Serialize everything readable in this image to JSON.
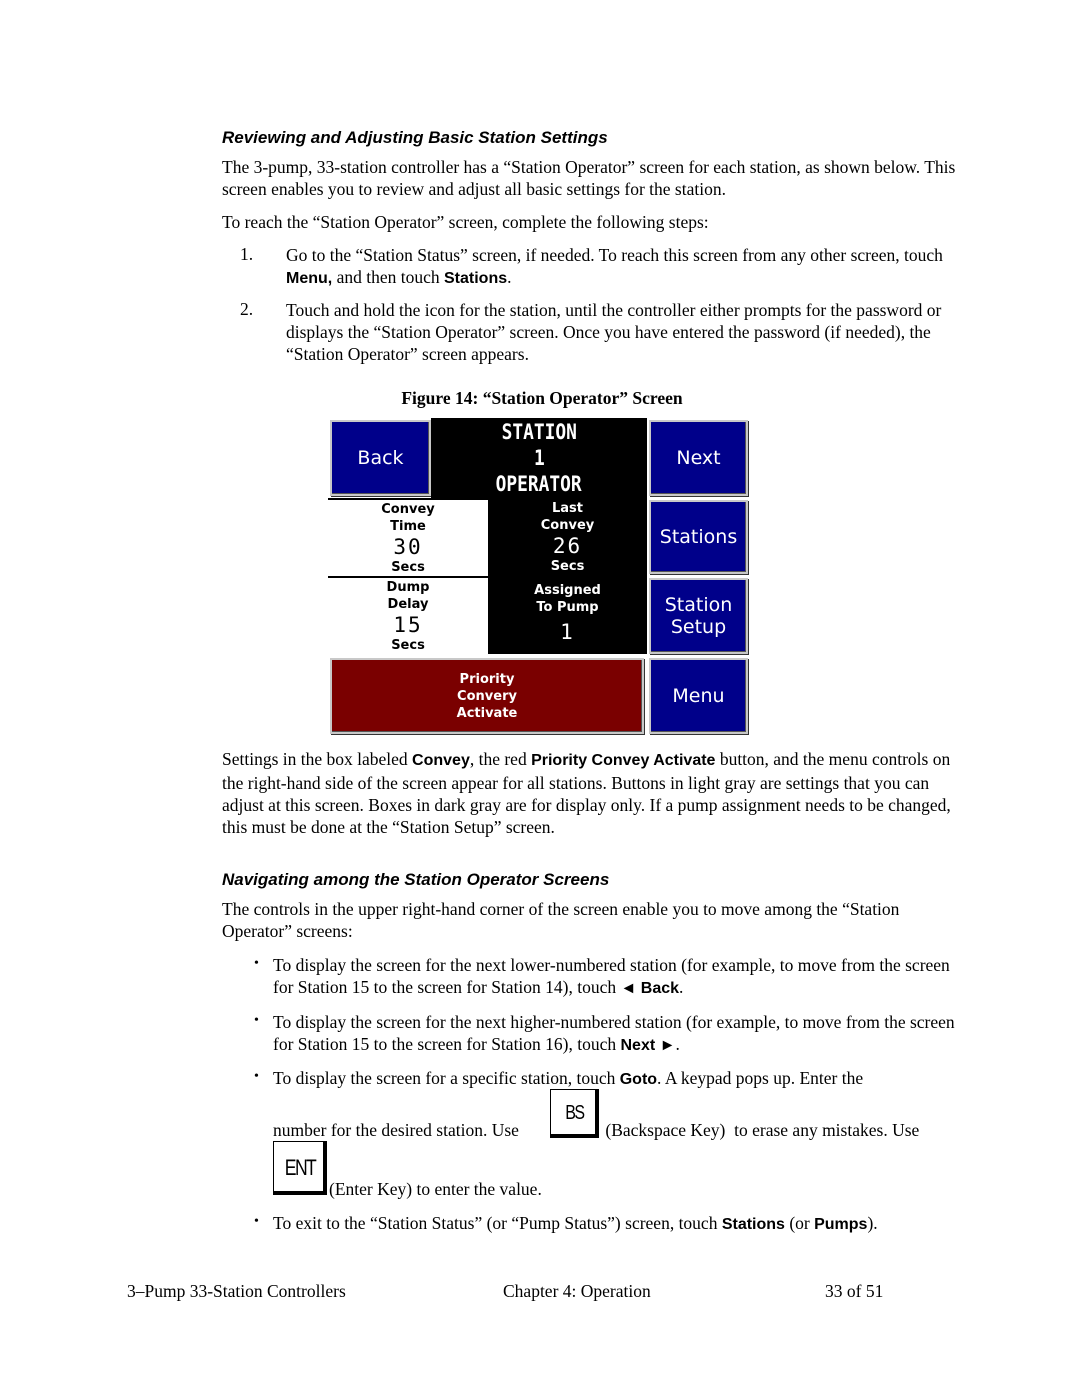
{
  "section1": {
    "heading": "Reviewing and Adjusting Basic Station Settings",
    "para1": "The 3-pump, 33-station controller has a “Station Operator” screen for each station, as shown below. This screen enables you to review and adjust all basic settings for the station.",
    "para2": "To reach the “Station Operator” screen, complete the following steps:",
    "steps": [
      {
        "num": "1.",
        "text_a": "Go to the “Station Status” screen, if needed. To reach this screen from any other screen, touch ",
        "bold_a": "Menu,",
        "text_b": " and then touch ",
        "bold_b": "Stations",
        "text_c": "."
      },
      {
        "num": "2.",
        "text": "Touch and hold the icon for the station, until the controller either prompts for the password or displays the “Station Operator” screen. Once you have entered the password (if needed), the “Station Operator” screen appears."
      }
    ]
  },
  "figure": {
    "caption": "Figure 14:  “Station Operator” Screen",
    "screen": {
      "back": "Back",
      "next": "Next",
      "title_line1": "STATION",
      "title_line2": "1",
      "title_line3": "OPERATOR",
      "convey_time": {
        "label1": "Convey",
        "label2": "Time",
        "value": "30",
        "unit": "Secs"
      },
      "last_convey": {
        "label1": "Last",
        "label2": "Convey",
        "value": "26",
        "unit": "Secs"
      },
      "dump_delay": {
        "label1": "Dump",
        "label2": "Delay",
        "value": "15",
        "unit": "Secs"
      },
      "assigned_pump": {
        "label1": "Assigned",
        "label2": "To Pump",
        "value": "1"
      },
      "stations": "Stations",
      "station_setup_1": "Station",
      "station_setup_2": "Setup",
      "priority_1": "Priority",
      "priority_2": "Convery",
      "priority_3": "Activate",
      "menu": "Menu"
    },
    "colors": {
      "button_blue": "#00008a",
      "priority_red": "#7a0000",
      "display_black": "#000000"
    }
  },
  "para3": {
    "t1": "Settings in the box labeled ",
    "b1": "Convey",
    "t2": ", the red ",
    "b2": "Priority Convey Activate",
    "t3": " button, and the menu controls on the right-hand side of the screen appear for all stations. Buttons in light gray are settings that you can adjust at this screen. Boxes in dark gray are for display only. If a pump assignment needs to be changed, this must be done at the “Station  Setup” screen."
  },
  "section2": {
    "heading": "Navigating among the Station Operator Screens",
    "intro": "The controls in the upper right-hand corner of the screen enable you to move among the “Station Operator” screens:",
    "bullets": [
      {
        "t1": "To display the screen for the next lower-numbered station (for example, to move from the screen for Station 15 to the screen for Station 14), touch ",
        "b1": "◄ Back",
        "t2": "."
      },
      {
        "t1": "To display the screen for the next higher-numbered station (for example, to move from the screen for Station 15 to the screen for Station 16), touch ",
        "b1": "Next ►",
        "t2": "."
      },
      {
        "t1": "To display the screen for a specific station, touch ",
        "b1": "Goto",
        "t2": ". A keypad pops up. Enter the",
        "line2a": "number for the desired station. Use ",
        "bs_key": "BS",
        "line2b": " (Backspace Key)  to erase any mistakes. Use",
        "ent_key": "ENT",
        "line3": " (Enter Key) to enter the value."
      },
      {
        "t1": "To exit to the “Station Status” (or “Pump Status”) screen, touch ",
        "b1": "Stations",
        "t2": " (or ",
        "b2": "Pumps",
        "t3": ")."
      }
    ],
    "bullet_char": "•"
  },
  "footer": {
    "left": "3–Pump 33-Station Controllers",
    "center": "Chapter 4:  Operation",
    "right": "33 of 51"
  }
}
